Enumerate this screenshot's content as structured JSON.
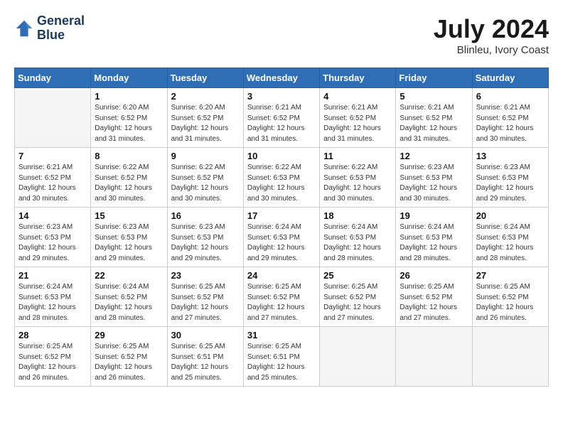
{
  "header": {
    "logo_line1": "General",
    "logo_line2": "Blue",
    "month_year": "July 2024",
    "location": "Blinleu, Ivory Coast"
  },
  "weekdays": [
    "Sunday",
    "Monday",
    "Tuesday",
    "Wednesday",
    "Thursday",
    "Friday",
    "Saturday"
  ],
  "weeks": [
    [
      {
        "day": "",
        "info": ""
      },
      {
        "day": "1",
        "info": "Sunrise: 6:20 AM\nSunset: 6:52 PM\nDaylight: 12 hours\nand 31 minutes."
      },
      {
        "day": "2",
        "info": "Sunrise: 6:20 AM\nSunset: 6:52 PM\nDaylight: 12 hours\nand 31 minutes."
      },
      {
        "day": "3",
        "info": "Sunrise: 6:21 AM\nSunset: 6:52 PM\nDaylight: 12 hours\nand 31 minutes."
      },
      {
        "day": "4",
        "info": "Sunrise: 6:21 AM\nSunset: 6:52 PM\nDaylight: 12 hours\nand 31 minutes."
      },
      {
        "day": "5",
        "info": "Sunrise: 6:21 AM\nSunset: 6:52 PM\nDaylight: 12 hours\nand 31 minutes."
      },
      {
        "day": "6",
        "info": "Sunrise: 6:21 AM\nSunset: 6:52 PM\nDaylight: 12 hours\nand 30 minutes."
      }
    ],
    [
      {
        "day": "7",
        "info": "Sunrise: 6:21 AM\nSunset: 6:52 PM\nDaylight: 12 hours\nand 30 minutes."
      },
      {
        "day": "8",
        "info": "Sunrise: 6:22 AM\nSunset: 6:52 PM\nDaylight: 12 hours\nand 30 minutes."
      },
      {
        "day": "9",
        "info": "Sunrise: 6:22 AM\nSunset: 6:52 PM\nDaylight: 12 hours\nand 30 minutes."
      },
      {
        "day": "10",
        "info": "Sunrise: 6:22 AM\nSunset: 6:53 PM\nDaylight: 12 hours\nand 30 minutes."
      },
      {
        "day": "11",
        "info": "Sunrise: 6:22 AM\nSunset: 6:53 PM\nDaylight: 12 hours\nand 30 minutes."
      },
      {
        "day": "12",
        "info": "Sunrise: 6:23 AM\nSunset: 6:53 PM\nDaylight: 12 hours\nand 30 minutes."
      },
      {
        "day": "13",
        "info": "Sunrise: 6:23 AM\nSunset: 6:53 PM\nDaylight: 12 hours\nand 29 minutes."
      }
    ],
    [
      {
        "day": "14",
        "info": "Sunrise: 6:23 AM\nSunset: 6:53 PM\nDaylight: 12 hours\nand 29 minutes."
      },
      {
        "day": "15",
        "info": "Sunrise: 6:23 AM\nSunset: 6:53 PM\nDaylight: 12 hours\nand 29 minutes."
      },
      {
        "day": "16",
        "info": "Sunrise: 6:23 AM\nSunset: 6:53 PM\nDaylight: 12 hours\nand 29 minutes."
      },
      {
        "day": "17",
        "info": "Sunrise: 6:24 AM\nSunset: 6:53 PM\nDaylight: 12 hours\nand 29 minutes."
      },
      {
        "day": "18",
        "info": "Sunrise: 6:24 AM\nSunset: 6:53 PM\nDaylight: 12 hours\nand 28 minutes."
      },
      {
        "day": "19",
        "info": "Sunrise: 6:24 AM\nSunset: 6:53 PM\nDaylight: 12 hours\nand 28 minutes."
      },
      {
        "day": "20",
        "info": "Sunrise: 6:24 AM\nSunset: 6:53 PM\nDaylight: 12 hours\nand 28 minutes."
      }
    ],
    [
      {
        "day": "21",
        "info": "Sunrise: 6:24 AM\nSunset: 6:53 PM\nDaylight: 12 hours\nand 28 minutes."
      },
      {
        "day": "22",
        "info": "Sunrise: 6:24 AM\nSunset: 6:52 PM\nDaylight: 12 hours\nand 28 minutes."
      },
      {
        "day": "23",
        "info": "Sunrise: 6:25 AM\nSunset: 6:52 PM\nDaylight: 12 hours\nand 27 minutes."
      },
      {
        "day": "24",
        "info": "Sunrise: 6:25 AM\nSunset: 6:52 PM\nDaylight: 12 hours\nand 27 minutes."
      },
      {
        "day": "25",
        "info": "Sunrise: 6:25 AM\nSunset: 6:52 PM\nDaylight: 12 hours\nand 27 minutes."
      },
      {
        "day": "26",
        "info": "Sunrise: 6:25 AM\nSunset: 6:52 PM\nDaylight: 12 hours\nand 27 minutes."
      },
      {
        "day": "27",
        "info": "Sunrise: 6:25 AM\nSunset: 6:52 PM\nDaylight: 12 hours\nand 26 minutes."
      }
    ],
    [
      {
        "day": "28",
        "info": "Sunrise: 6:25 AM\nSunset: 6:52 PM\nDaylight: 12 hours\nand 26 minutes."
      },
      {
        "day": "29",
        "info": "Sunrise: 6:25 AM\nSunset: 6:52 PM\nDaylight: 12 hours\nand 26 minutes."
      },
      {
        "day": "30",
        "info": "Sunrise: 6:25 AM\nSunset: 6:51 PM\nDaylight: 12 hours\nand 25 minutes."
      },
      {
        "day": "31",
        "info": "Sunrise: 6:25 AM\nSunset: 6:51 PM\nDaylight: 12 hours\nand 25 minutes."
      },
      {
        "day": "",
        "info": ""
      },
      {
        "day": "",
        "info": ""
      },
      {
        "day": "",
        "info": ""
      }
    ]
  ]
}
